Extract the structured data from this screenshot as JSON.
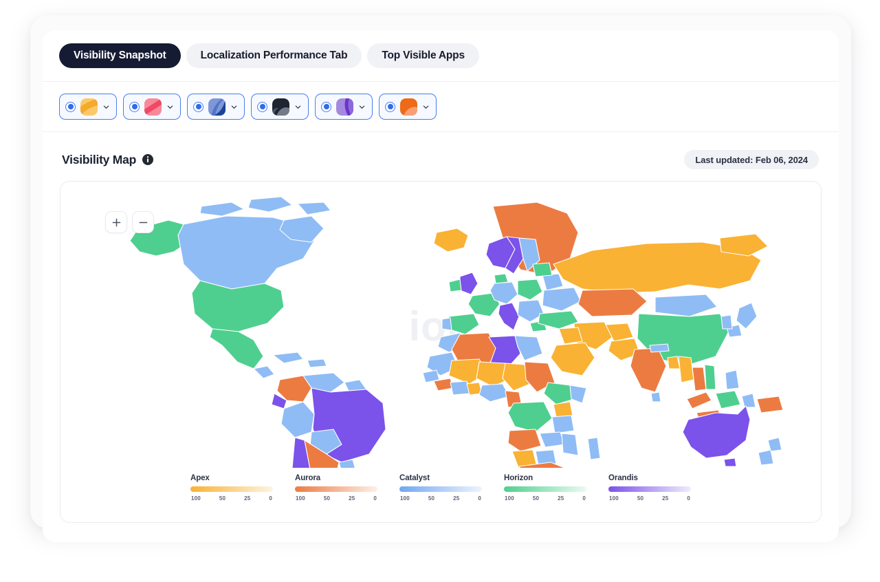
{
  "tabs": [
    {
      "label": "Visibility Snapshot",
      "active": true
    },
    {
      "label": "Localization Performance Tab",
      "active": false
    },
    {
      "label": "Top Visible Apps",
      "active": false
    }
  ],
  "app_filters": [
    {
      "name": "app-filter-1",
      "selected": true,
      "icon_colors": [
        "#f9b233",
        "#fcd98a"
      ],
      "chevron": "chevron-down-icon"
    },
    {
      "name": "app-filter-2",
      "selected": true,
      "icon_colors": [
        "#f1546c",
        "#f98a98"
      ],
      "chevron": "chevron-down-icon"
    },
    {
      "name": "app-filter-3",
      "selected": true,
      "icon_colors": [
        "#1f4fa8",
        "#8fa9e0"
      ],
      "chevron": "chevron-down-icon"
    },
    {
      "name": "app-filter-4",
      "selected": true,
      "icon_colors": [
        "#232a38",
        "#79808f"
      ],
      "chevron": "chevron-down-icon"
    },
    {
      "name": "app-filter-5",
      "selected": true,
      "icon_colors": [
        "#7b3fd4",
        "#b79ae4"
      ],
      "chevron": "chevron-down-icon"
    },
    {
      "name": "app-filter-6",
      "selected": true,
      "icon_colors": [
        "#ef6a16",
        "#f79f77"
      ],
      "chevron": "chevron-down-icon"
    }
  ],
  "map_section": {
    "title": "Visibility Map",
    "info_icon": "info-icon",
    "last_updated": "Last updated: Feb 06, 2024",
    "watermark": "ion",
    "zoom_in_label": "+",
    "zoom_out_label": "−"
  },
  "chart_data": {
    "type": "map",
    "title": "Visibility Map",
    "legend_position": "bottom-center",
    "scale_ticks": [
      "100",
      "50",
      "25",
      "0"
    ],
    "series": [
      {
        "name": "Apex",
        "color": "#f9b233",
        "color_light": "#fdf4e2"
      },
      {
        "name": "Aurora",
        "color": "#ec7b42",
        "color_light": "#fdf0e9"
      },
      {
        "name": "Catalyst",
        "color": "#71a7f0",
        "color_light": "#eef4fd"
      },
      {
        "name": "Horizon",
        "color": "#4fcf8f",
        "color_light": "#ecfaf3"
      },
      {
        "name": "Orandis",
        "color": "#7b52ea",
        "color_light": "#f0ecfd"
      }
    ],
    "regions": [
      {
        "id": "united-states",
        "series": "Horizon"
      },
      {
        "id": "canada",
        "series": "Catalyst"
      },
      {
        "id": "mexico",
        "series": "Horizon"
      },
      {
        "id": "greenland",
        "series": "Aurora"
      },
      {
        "id": "alaska",
        "series": "Horizon"
      },
      {
        "id": "iceland",
        "series": "Apex"
      },
      {
        "id": "brazil",
        "series": "Orandis"
      },
      {
        "id": "argentina",
        "series": "Aurora"
      },
      {
        "id": "chile",
        "series": "Orandis"
      },
      {
        "id": "peru",
        "series": "Catalyst"
      },
      {
        "id": "colombia",
        "series": "Aurora"
      },
      {
        "id": "venezuela",
        "series": "Catalyst"
      },
      {
        "id": "bolivia",
        "series": "Catalyst"
      },
      {
        "id": "russia",
        "series": "Apex"
      },
      {
        "id": "china",
        "series": "Horizon"
      },
      {
        "id": "india",
        "series": "Aurora"
      },
      {
        "id": "kazakhstan",
        "series": "Aurora"
      },
      {
        "id": "mongolia",
        "series": "Catalyst"
      },
      {
        "id": "iran",
        "series": "Apex"
      },
      {
        "id": "saudi-arabia",
        "series": "Apex"
      },
      {
        "id": "turkey",
        "series": "Horizon"
      },
      {
        "id": "australia",
        "series": "Orandis"
      },
      {
        "id": "new-zealand",
        "series": "Catalyst"
      },
      {
        "id": "indonesia",
        "series": "Horizon"
      },
      {
        "id": "japan",
        "series": "Catalyst"
      },
      {
        "id": "algeria",
        "series": "Aurora"
      },
      {
        "id": "libya",
        "series": "Orandis"
      },
      {
        "id": "egypt",
        "series": "Catalyst"
      },
      {
        "id": "sudan",
        "series": "Aurora"
      },
      {
        "id": "chad",
        "series": "Apex"
      },
      {
        "id": "niger",
        "series": "Apex"
      },
      {
        "id": "mali",
        "series": "Apex"
      },
      {
        "id": "nigeria",
        "series": "Catalyst"
      },
      {
        "id": "dr-congo",
        "series": "Horizon"
      },
      {
        "id": "angola",
        "series": "Aurora"
      },
      {
        "id": "south-africa",
        "series": "Aurora"
      },
      {
        "id": "ethiopia",
        "series": "Horizon"
      },
      {
        "id": "namibia",
        "series": "Apex"
      },
      {
        "id": "france",
        "series": "Horizon"
      },
      {
        "id": "spain",
        "series": "Horizon"
      },
      {
        "id": "germany",
        "series": "Catalyst"
      },
      {
        "id": "poland",
        "series": "Horizon"
      },
      {
        "id": "ukraine",
        "series": "Catalyst"
      },
      {
        "id": "sweden",
        "series": "Orandis"
      },
      {
        "id": "norway",
        "series": "Orandis"
      },
      {
        "id": "finland",
        "series": "Catalyst"
      },
      {
        "id": "united-kingdom",
        "series": "Orandis"
      },
      {
        "id": "italy",
        "series": "Orandis"
      }
    ]
  }
}
